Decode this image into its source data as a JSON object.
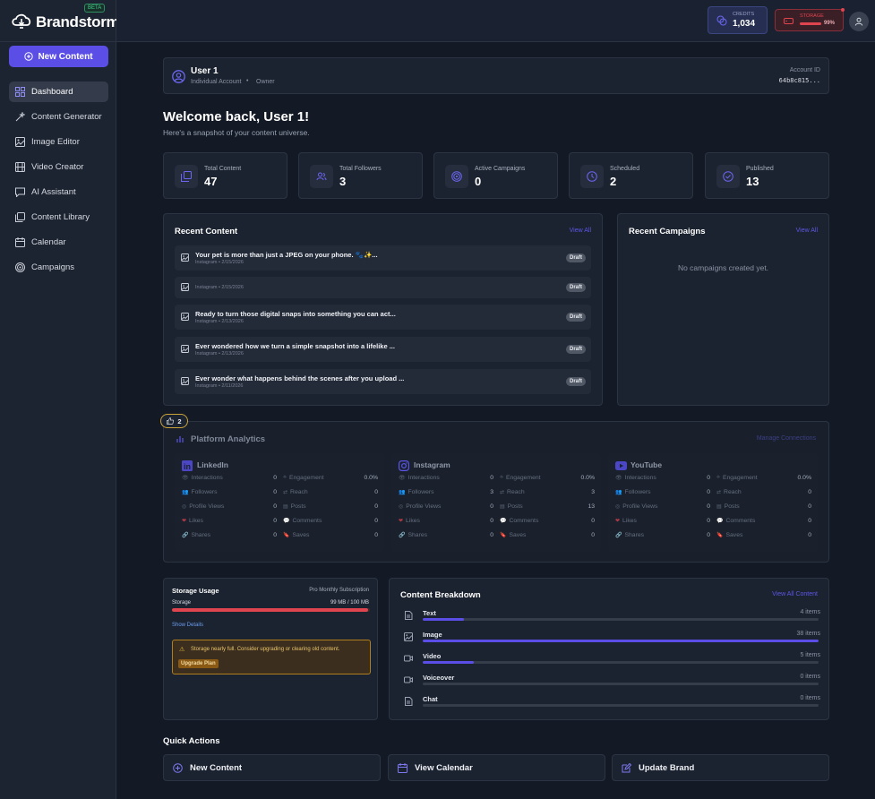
{
  "app": {
    "name": "Brandstorm",
    "badge": "BETA"
  },
  "sidebar": {
    "new_content": "New Content",
    "items": [
      {
        "label": "Dashboard",
        "icon": "grid-icon",
        "active": true
      },
      {
        "label": "Content Generator",
        "icon": "magic-wand-icon"
      },
      {
        "label": "Image Editor",
        "icon": "image-edit-icon"
      },
      {
        "label": "Video Creator",
        "icon": "film-icon"
      },
      {
        "label": "AI Assistant",
        "icon": "chat-icon"
      },
      {
        "label": "Content Library",
        "icon": "library-icon"
      },
      {
        "label": "Calendar",
        "icon": "calendar-icon"
      },
      {
        "label": "Campaigns",
        "icon": "target-icon"
      }
    ]
  },
  "topbar": {
    "credits_label": "CREDITS",
    "credits_value": "1,034",
    "storage_label": "STORAGE",
    "storage_percent": "99%",
    "storage_fill": 0.99,
    "colors": {
      "credits_accent": "#5b56e6",
      "storage_accent": "#e0444f"
    }
  },
  "user": {
    "name": "User 1",
    "account_type": "Individual Account",
    "role": "Owner",
    "account_id_label": "Account ID",
    "account_id": "64b8c815..."
  },
  "welcome": {
    "title": "Welcome back, User 1!",
    "subtitle": "Here's a snapshot of your content universe."
  },
  "stats": [
    {
      "label": "Total Content",
      "value": "47",
      "icon": "stack-icon"
    },
    {
      "label": "Total Followers",
      "value": "3",
      "icon": "users-icon"
    },
    {
      "label": "Active Campaigns",
      "value": "0",
      "icon": "target-icon"
    },
    {
      "label": "Scheduled",
      "value": "2",
      "icon": "clock-icon"
    },
    {
      "label": "Published",
      "value": "13",
      "icon": "check-circle-icon"
    }
  ],
  "recent_content": {
    "title": "Recent Content",
    "view_all": "View All",
    "items": [
      {
        "title": "Your pet is more than just a JPEG on your phone. 🐾✨...",
        "meta": "Instagram • 2/15/2026",
        "status": "Draft"
      },
      {
        "title": "",
        "meta": "Instagram • 2/15/2026",
        "status": "Draft"
      },
      {
        "title": "Ready to turn those digital snaps into something you can act...",
        "meta": "Instagram • 2/13/2026",
        "status": "Draft"
      },
      {
        "title": "Ever wondered how we turn a simple snapshot into a lifelike ...",
        "meta": "Instagram • 2/13/2026",
        "status": "Draft"
      },
      {
        "title": "Ever wonder what happens behind the scenes after you upload ...",
        "meta": "Instagram • 2/11/2026",
        "status": "Draft"
      }
    ]
  },
  "recent_campaigns": {
    "title": "Recent Campaigns",
    "view_all": "View All",
    "empty": "No campaigns created yet."
  },
  "analytics": {
    "likes_badge": "2",
    "title": "Platform Analytics",
    "manage": "Manage Connections",
    "platforms": [
      {
        "name": "LinkedIn",
        "icon": "linkedin-icon",
        "left": [
          [
            "Interactions",
            "0"
          ],
          [
            "Followers",
            "0"
          ],
          [
            "Profile Views",
            "0"
          ],
          [
            "Likes",
            "0"
          ],
          [
            "Shares",
            "0"
          ]
        ],
        "right": [
          [
            "Engagement",
            "0.0%"
          ],
          [
            "Reach",
            "0"
          ],
          [
            "Posts",
            "0"
          ],
          [
            "Comments",
            "0"
          ],
          [
            "Saves",
            "0"
          ]
        ]
      },
      {
        "name": "Instagram",
        "icon": "instagram-icon",
        "left": [
          [
            "Interactions",
            "0"
          ],
          [
            "Followers",
            "3"
          ],
          [
            "Profile Views",
            "0"
          ],
          [
            "Likes",
            "0"
          ],
          [
            "Shares",
            "0"
          ]
        ],
        "right": [
          [
            "Engagement",
            "0.0%"
          ],
          [
            "Reach",
            "3"
          ],
          [
            "Posts",
            "13"
          ],
          [
            "Comments",
            "0"
          ],
          [
            "Saves",
            "0"
          ]
        ]
      },
      {
        "name": "YouTube",
        "icon": "youtube-icon",
        "left": [
          [
            "Interactions",
            "0"
          ],
          [
            "Followers",
            "0"
          ],
          [
            "Profile Views",
            "0"
          ],
          [
            "Likes",
            "0"
          ],
          [
            "Shares",
            "0"
          ]
        ],
        "right": [
          [
            "Engagement",
            "0.0%"
          ],
          [
            "Reach",
            "0"
          ],
          [
            "Posts",
            "0"
          ],
          [
            "Comments",
            "0"
          ],
          [
            "Saves",
            "0"
          ]
        ]
      }
    ]
  },
  "storage": {
    "title": "Storage Usage",
    "plan": "Pro Monthly Subscription",
    "label": "Storage",
    "usage": "99 MB / 100 MB",
    "fill": 0.99,
    "show_details": "Show Details",
    "warning": "Storage nearly full. Consider upgrading or clearing old content.",
    "upgrade": "Upgrade Plan"
  },
  "breakdown": {
    "title": "Content Breakdown",
    "view_all": "View All Content",
    "items": [
      {
        "label": "Text",
        "count": "4 items",
        "fraction": 0.105,
        "icon": "document-icon"
      },
      {
        "label": "Image",
        "count": "38 items",
        "fraction": 1.0,
        "icon": "image-icon"
      },
      {
        "label": "Video",
        "count": "5 items",
        "fraction": 0.13,
        "icon": "video-icon"
      },
      {
        "label": "Voiceover",
        "count": "0 items",
        "fraction": 0,
        "icon": "microphone-icon"
      },
      {
        "label": "Chat",
        "count": "0 items",
        "fraction": 0,
        "icon": "chat-doc-icon"
      }
    ]
  },
  "quick_actions": {
    "title": "Quick Actions",
    "items": [
      {
        "label": "New Content",
        "icon": "plus-circle-icon"
      },
      {
        "label": "View Calendar",
        "icon": "calendar-icon"
      },
      {
        "label": "Update Brand",
        "icon": "edit-icon"
      }
    ]
  }
}
